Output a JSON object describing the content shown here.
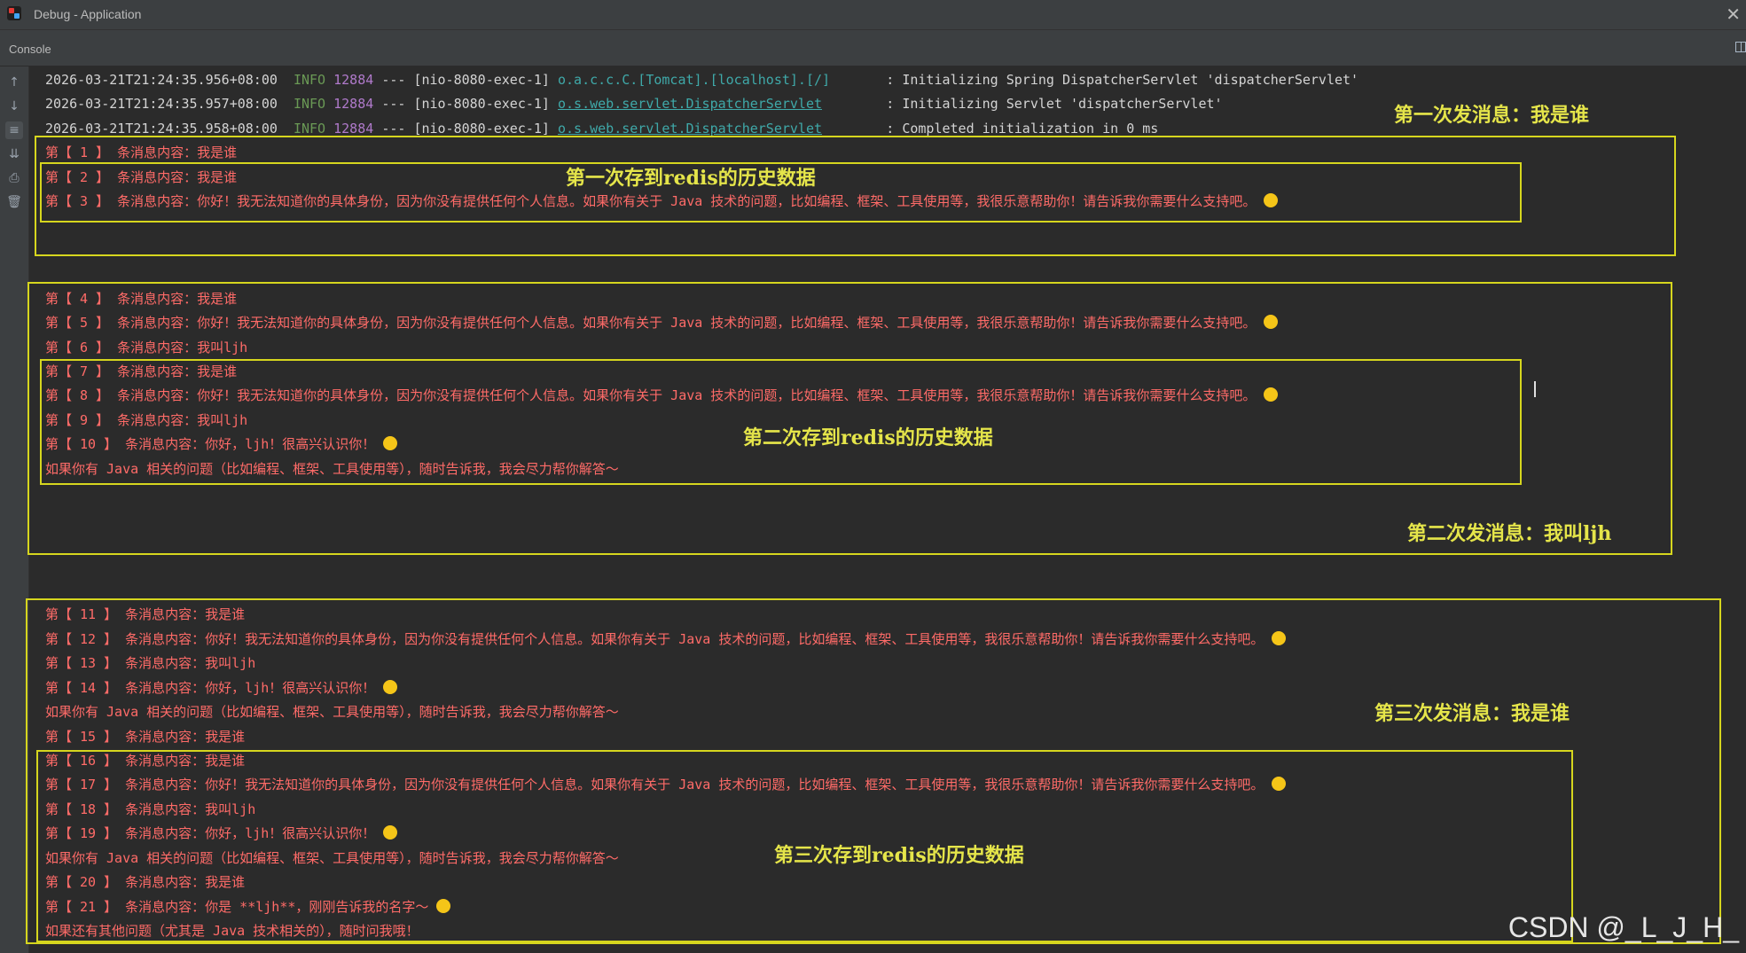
{
  "window": {
    "title": "Debug - Application"
  },
  "tool": {
    "tab": "Console"
  },
  "log": [
    {
      "ts": "2026-03-21T21:24:35.956+08:00",
      "level": "INFO",
      "pid": "12884",
      "sep": "---",
      "thread": "[nio-8080-exec-1]",
      "logger": "o.a.c.c.C.[Tomcat].[localhost].[/]",
      "msg": ": Initializing Spring DispatcherServlet 'dispatcherServlet'"
    },
    {
      "ts": "2026-03-21T21:24:35.957+08:00",
      "level": "INFO",
      "pid": "12884",
      "sep": "---",
      "thread": "[nio-8080-exec-1]",
      "logger": "o.s.web.servlet.DispatcherServlet",
      "msg": ": Initializing Servlet 'dispatcherServlet'"
    },
    {
      "ts": "2026-03-21T21:24:35.958+08:00",
      "level": "INFO",
      "pid": "12884",
      "sep": "---",
      "thread": "[nio-8080-exec-1]",
      "logger": "o.s.web.servlet.DispatcherServlet",
      "msg": ": Completed initialization in 0 ms"
    }
  ],
  "messages": [
    "第【 1 】 条消息内容：我是谁",
    "第【 2 】 条消息内容：我是谁",
    "第【 3 】 条消息内容：你好！我无法知道你的具体身份，因为你没有提供任何个人信息。如果你有关于 Java 技术的问题，比如编程、框架、工具使用等，我很乐意帮助你！请告诉我你需要什么支持吧。 ",
    "第【 4 】 条消息内容：我是谁",
    "第【 5 】 条消息内容：你好！我无法知道你的具体身份，因为你没有提供任何个人信息。如果你有关于 Java 技术的问题，比如编程、框架、工具使用等，我很乐意帮助你！请告诉我你需要什么支持吧。 ",
    "第【 6 】 条消息内容：我叫ljh",
    "第【 7 】 条消息内容：我是谁",
    "第【 8 】 条消息内容：你好！我无法知道你的具体身份，因为你没有提供任何个人信息。如果你有关于 Java 技术的问题，比如编程、框架、工具使用等，我很乐意帮助你！请告诉我你需要什么支持吧。 ",
    "第【 9 】 条消息内容：我叫ljh",
    "第【 10 】 条消息内容：你好，ljh！很高兴认识你！",
    "如果你有 Java 相关的问题（比如编程、框架、工具使用等），随时告诉我，我会尽力帮你解答～",
    "第【 11 】 条消息内容：我是谁",
    "第【 12 】 条消息内容：你好！我无法知道你的具体身份，因为你没有提供任何个人信息。如果你有关于 Java 技术的问题，比如编程、框架、工具使用等，我很乐意帮助你！请告诉我你需要什么支持吧。 ",
    "第【 13 】 条消息内容：我叫ljh",
    "第【 14 】 条消息内容：你好，ljh！很高兴认识你！",
    "如果你有 Java 相关的问题（比如编程、框架、工具使用等），随时告诉我，我会尽力帮你解答～",
    "第【 15 】 条消息内容：我是谁",
    "第【 16 】 条消息内容：我是谁",
    "第【 17 】 条消息内容：你好！我无法知道你的具体身份，因为你没有提供任何个人信息。如果你有关于 Java 技术的问题，比如编程、框架、工具使用等，我很乐意帮助你！请告诉我你需要什么支持吧。 ",
    "第【 18 】 条消息内容：我叫ljh",
    "第【 19 】 条消息内容：你好，ljh！很高兴认识你！",
    "如果你有 Java 相关的问题（比如编程、框架、工具使用等），随时告诉我，我会尽力帮你解答～",
    "第【 20 】 条消息内容：我是谁",
    "第【 21 】 条消息内容：你是 **ljh**，刚刚告诉我的名字～ ",
    "如果还有其他问题（尤其是 Java 技术相关的），随时问我哦！"
  ],
  "annotations": {
    "first_send": "第一次发消息：我是谁",
    "first_redis": "第一次存到redis的历史数据",
    "second_redis": "第二次存到redis的历史数据",
    "second_send": "第二次发消息：我叫ljh",
    "third_send": "第三次发消息：我是谁",
    "third_redis": "第三次存到redis的历史数据"
  },
  "watermark": "CSDN @_L_J_H_",
  "colors": {
    "background": "#2b2b2b",
    "message_text": "#ff6b68",
    "info_level": "#6a9955",
    "pid": "#b07acb",
    "logger": "#3fa9a9",
    "annotation": "#e5e54a"
  },
  "icons": [
    "up-arrow-icon",
    "down-arrow-icon",
    "soft-wrap-icon",
    "scroll-to-end-icon",
    "print-icon",
    "trash-icon",
    "smile-emoji-icon"
  ]
}
